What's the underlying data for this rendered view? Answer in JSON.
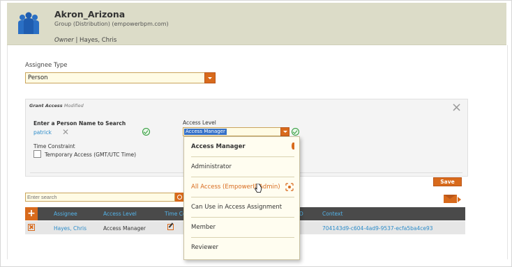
{
  "header": {
    "title": "Akron_Arizona",
    "subtitle": "Group (Distribution) (empowerbpm.com)",
    "owner_label": "Owner",
    "owner_sep": " | ",
    "owner_value": "Hayes, Chris"
  },
  "assignee_type": {
    "label": "Assignee Type",
    "value": "Person"
  },
  "grant": {
    "title": "Grant Access",
    "status": "Modified",
    "person_label": "Enter a Person Name to Search",
    "person_value": "patrick",
    "access_level_label": "Access Level",
    "access_level_value": "Access Manager",
    "time_constraint_label": "Time Constraint",
    "temporary_label": "Temporary Access (GMT/UTC Time)",
    "save_label": "Save"
  },
  "search": {
    "placeholder": "Enter search"
  },
  "table": {
    "add_label": "+",
    "columns": [
      "Assignee",
      "Access Level",
      "Time Co",
      "D",
      "Context"
    ],
    "rows": [
      {
        "assignee": "Hayes, Chris",
        "access_level": "Access Manager",
        "context": "704143d9-c604-4ad9-9537-ecfa5ba4ce93"
      }
    ]
  },
  "dropdown": {
    "items": [
      "Access Manager",
      "Administrator",
      "All Access (EmpowerIDAdmin)",
      "Can Use in Access Assignment",
      "Member",
      "Reviewer"
    ],
    "selected_index": 0,
    "hover_index": 2
  },
  "colors": {
    "accent": "#d86a1c",
    "link": "#2a8bc9",
    "header_bg": "#dcdcc8"
  }
}
